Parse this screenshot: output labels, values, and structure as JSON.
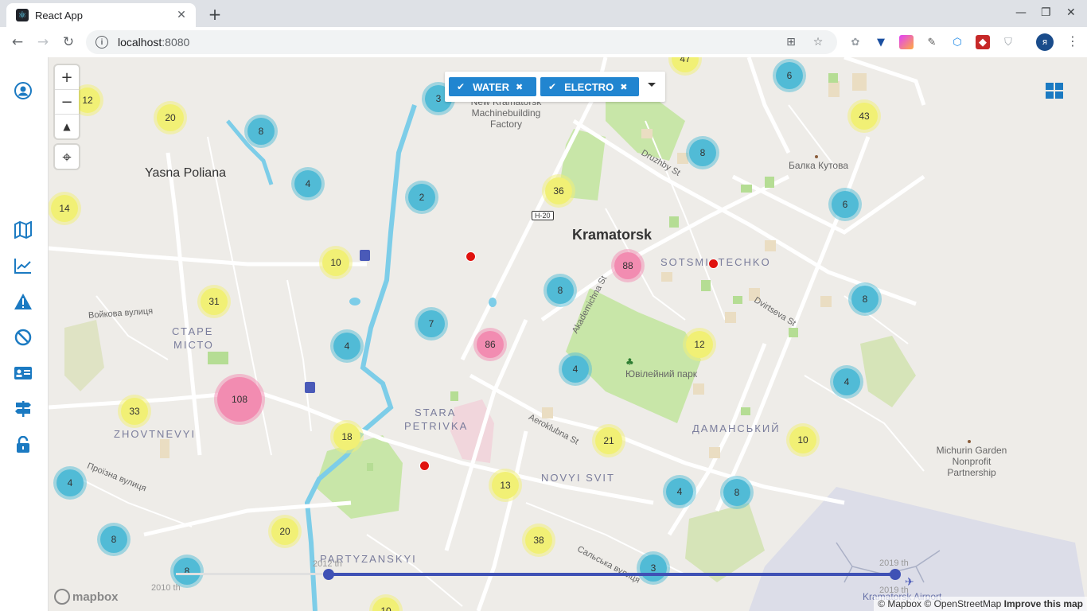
{
  "browser": {
    "tab_title": "React App",
    "tab_close": "✕",
    "new_tab": "+",
    "url_host": "localhost",
    "url_port": ":8080",
    "profile_initial": "я"
  },
  "filters": {
    "chips": [
      {
        "label": "WATER",
        "check": "✔",
        "remove": "✖"
      },
      {
        "label": "ELECTRO",
        "check": "✔",
        "remove": "✖"
      }
    ]
  },
  "map": {
    "places": {
      "yasna_poliana": "Yasna Poliana",
      "kramatorsk": "Kramatorsk",
      "voikova": "Войкова вулиця",
      "proizna": "Проїзна вулиця",
      "balka": "Балка Кутова",
      "michurin": "Michurin Garden Nonprofit Partnership",
      "factory": "New Kramatorsk Machinebuilding Factory",
      "park": "Ювілейний парк",
      "airport": "Kramatorsk Airport",
      "salska": "Сальська вулиця",
      "druzhby": "Druzhby St",
      "akademichna": "Akademichna St",
      "dvirtseva": "Dvirtseva St",
      "aeroklubna": "Aeroklubna St",
      "road": "H-20"
    },
    "districts": {
      "stare_misto_1": "СТАРЕ",
      "stare_misto_2": "МІСТО",
      "sotsmistechko": "SOTSMISTECHKO",
      "stara_petrivka_1": "STARA",
      "stara_petrivka_2": "PETRIVKA",
      "zhovtnevyi": "ZHOVTNEVYI",
      "damanskyi": "ДАМАНСЬКИЙ",
      "novyi_svit": "NOVYI SVIT",
      "partyzanskyi": "PARTYZANSKYI"
    },
    "clusters": [
      {
        "n": "12",
        "c": "yellow"
      },
      {
        "n": "20",
        "c": "yellow"
      },
      {
        "n": "8",
        "c": "blue"
      },
      {
        "n": "4",
        "c": "blue"
      },
      {
        "n": "14",
        "c": "yellow"
      },
      {
        "n": "3",
        "c": "blue"
      },
      {
        "n": "2",
        "c": "blue"
      },
      {
        "n": "10",
        "c": "yellow"
      },
      {
        "n": "31",
        "c": "yellow"
      },
      {
        "n": "7",
        "c": "blue"
      },
      {
        "n": "4",
        "c": "blue"
      },
      {
        "n": "86",
        "c": "pink"
      },
      {
        "n": "108",
        "c": "pink"
      },
      {
        "n": "33",
        "c": "yellow"
      },
      {
        "n": "18",
        "c": "yellow"
      },
      {
        "n": "4",
        "c": "blue"
      },
      {
        "n": "8",
        "c": "blue"
      },
      {
        "n": "20",
        "c": "yellow"
      },
      {
        "n": "8",
        "c": "blue"
      },
      {
        "n": "13",
        "c": "yellow"
      },
      {
        "n": "38",
        "c": "yellow"
      },
      {
        "n": "3",
        "c": "blue"
      },
      {
        "n": "36",
        "c": "yellow"
      },
      {
        "n": "8",
        "c": "blue"
      },
      {
        "n": "88",
        "c": "pink"
      },
      {
        "n": "4",
        "c": "blue"
      },
      {
        "n": "12",
        "c": "yellow"
      },
      {
        "n": "21",
        "c": "yellow"
      },
      {
        "n": "4",
        "c": "blue"
      },
      {
        "n": "8",
        "c": "blue"
      },
      {
        "n": "6",
        "c": "blue"
      },
      {
        "n": "43",
        "c": "yellow"
      },
      {
        "n": "8",
        "c": "blue"
      },
      {
        "n": "6",
        "c": "blue"
      },
      {
        "n": "8",
        "c": "blue"
      },
      {
        "n": "4",
        "c": "blue"
      },
      {
        "n": "10",
        "c": "yellow"
      },
      {
        "n": "47",
        "c": "yellow"
      },
      {
        "n": "10",
        "c": "yellow"
      }
    ],
    "timeline": {
      "left_label": "2010 th",
      "start_label": "2012 th",
      "end_label": "2019 th",
      "end_label2": "2019 th"
    },
    "attribution": {
      "mapbox": "© Mapbox",
      "osm": "© OpenStreetMap",
      "improve": "Improve this map"
    },
    "logo": "mapbox"
  }
}
